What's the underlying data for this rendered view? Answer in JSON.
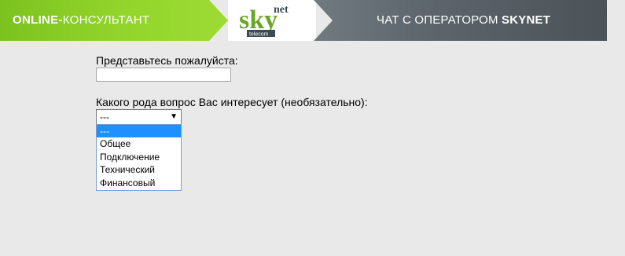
{
  "header": {
    "brand_bold": "ONLINE-",
    "brand_rest": "КОНСУЛЬТАНТ",
    "logo": {
      "main": "sky",
      "sup": "net",
      "sub": "telecom"
    },
    "chat_title_prefix": "ЧАТ С ОПЕРАТОРОМ ",
    "chat_title_bold": "SKYNET",
    "colors": {
      "green": "#8ccf25",
      "dark": "#5c656b",
      "logo_green": "#6aa626",
      "logo_dark": "#3c4a52"
    }
  },
  "form": {
    "name_label": "Представьтесь пожалуйста:",
    "name_value": "",
    "topic_label": "Какого рода вопрос Вас интересует (необязательно):",
    "topic_selected": "---",
    "topic_options": [
      "---",
      "Общее",
      "Подключение",
      "Технический",
      "Финансовый"
    ]
  },
  "icons": {
    "dropdown_arrow": "caret-down-icon"
  }
}
